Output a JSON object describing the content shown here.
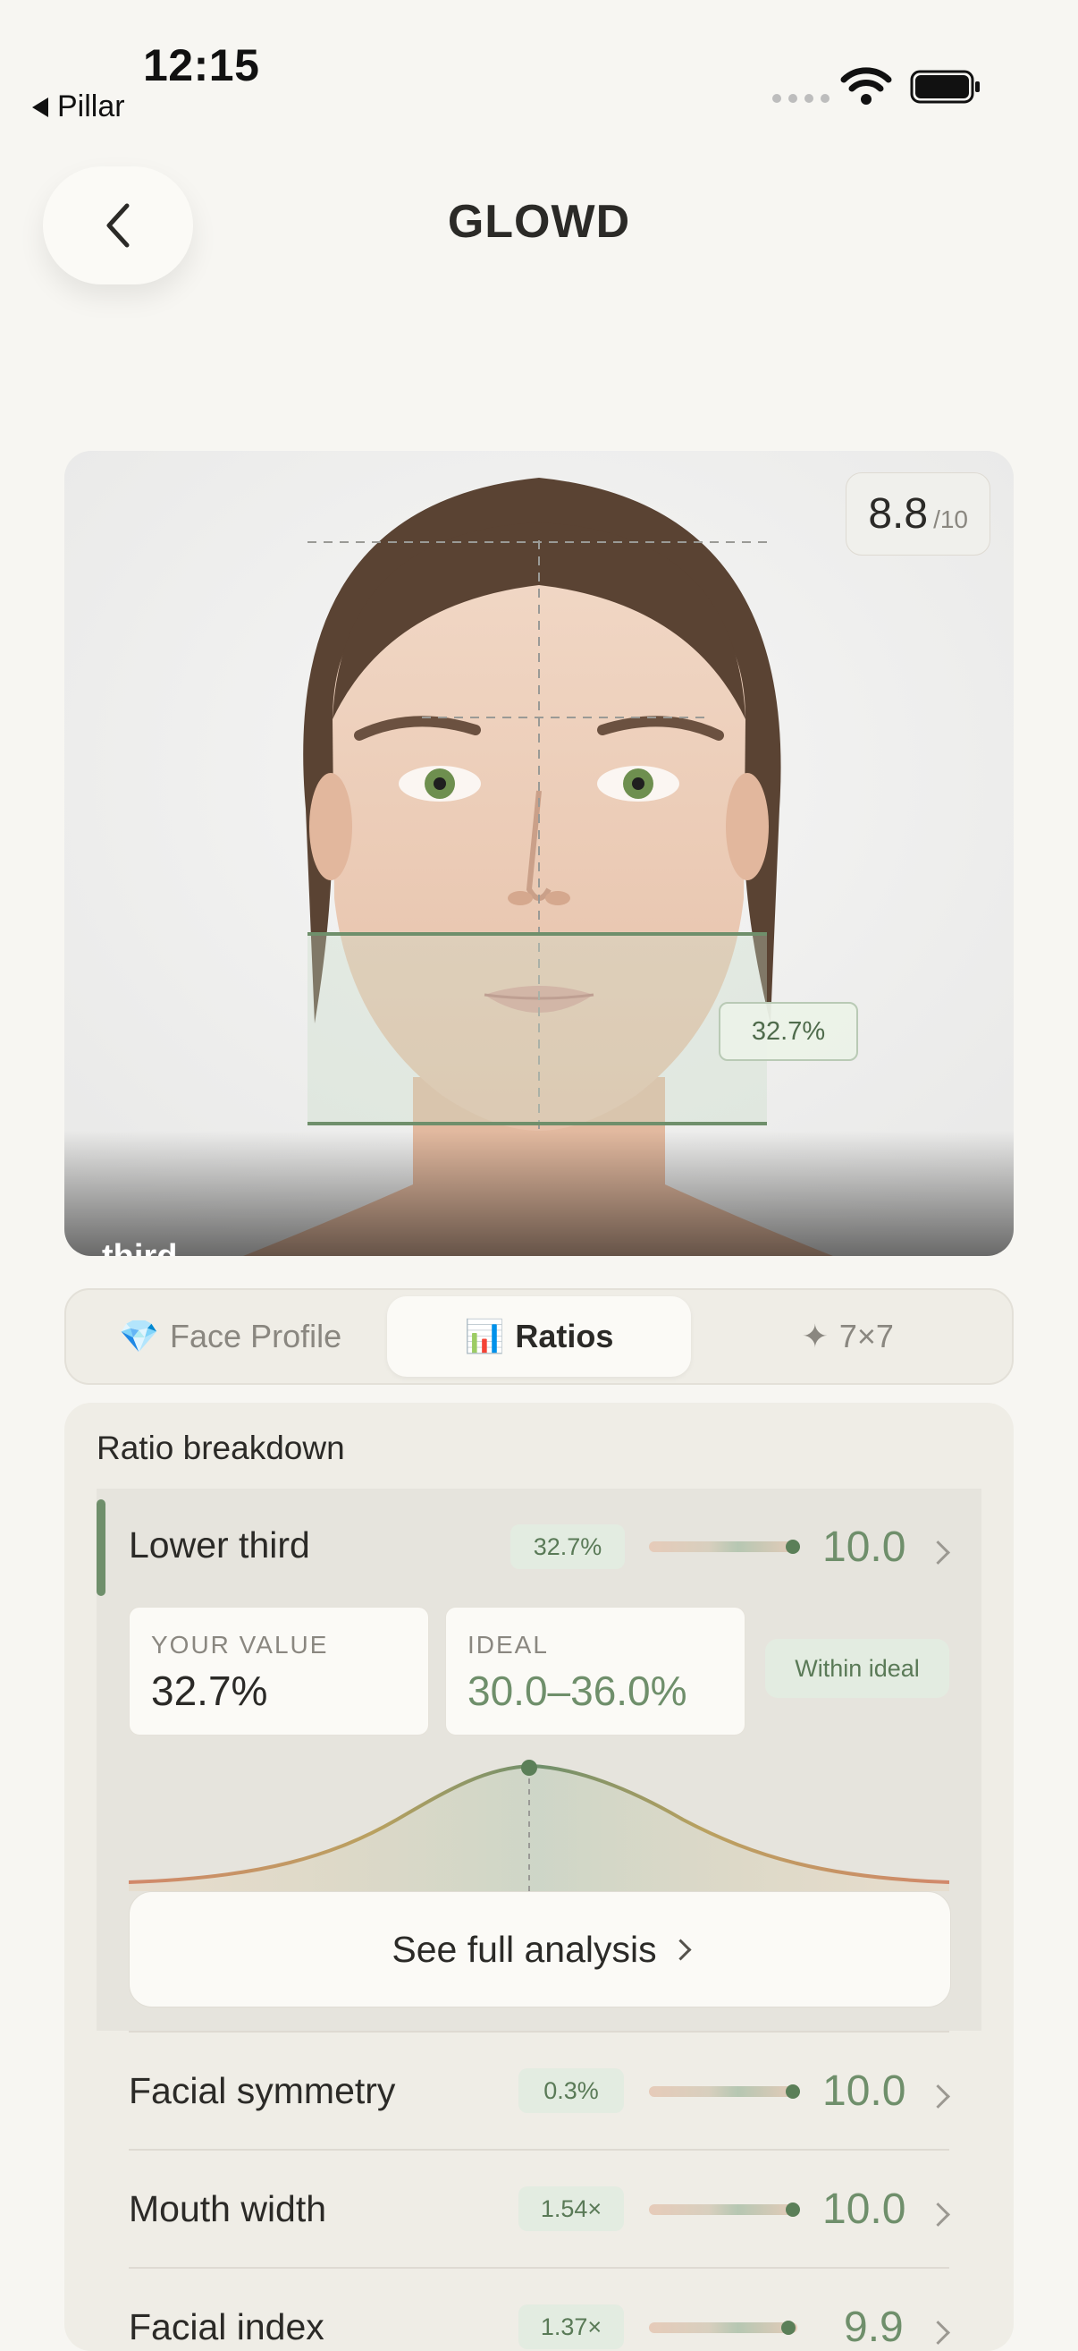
{
  "status_bar": {
    "time": "12:15",
    "back_app": "Pillar"
  },
  "header": {
    "title": "GLOWD",
    "back_icon": "chevron-left-icon"
  },
  "photo": {
    "score": "8.8",
    "score_suffix": "/10",
    "measure_label": "32.7%",
    "caption": "third"
  },
  "tabs": [
    {
      "icon": "💎",
      "label": "Face Profile",
      "active": false
    },
    {
      "icon": "📊",
      "label": "Ratios",
      "active": true
    },
    {
      "icon": "✦",
      "label": "7×7",
      "active": false
    }
  ],
  "panel": {
    "title": "Ratio breakdown",
    "expanded": {
      "label": "Lower third",
      "value_chip": "32.7%",
      "score": "10.0",
      "your_value_caption": "YOUR VALUE",
      "your_value": "32.7%",
      "ideal_caption": "IDEAL",
      "ideal_range": "30.0–36.0%",
      "badge": "Within ideal",
      "button_label": "See full analysis"
    },
    "rows": [
      {
        "label": "Facial symmetry",
        "chip": "0.3%",
        "score": "10.0"
      },
      {
        "label": "Mouth width",
        "chip": "1.54×",
        "score": "10.0"
      },
      {
        "label": "Facial index",
        "chip": "1.37×",
        "score": "9.9"
      }
    ]
  },
  "colors": {
    "accent_green": "#6f8f6b",
    "background": "#f7f6f2",
    "panel": "#efede6"
  }
}
